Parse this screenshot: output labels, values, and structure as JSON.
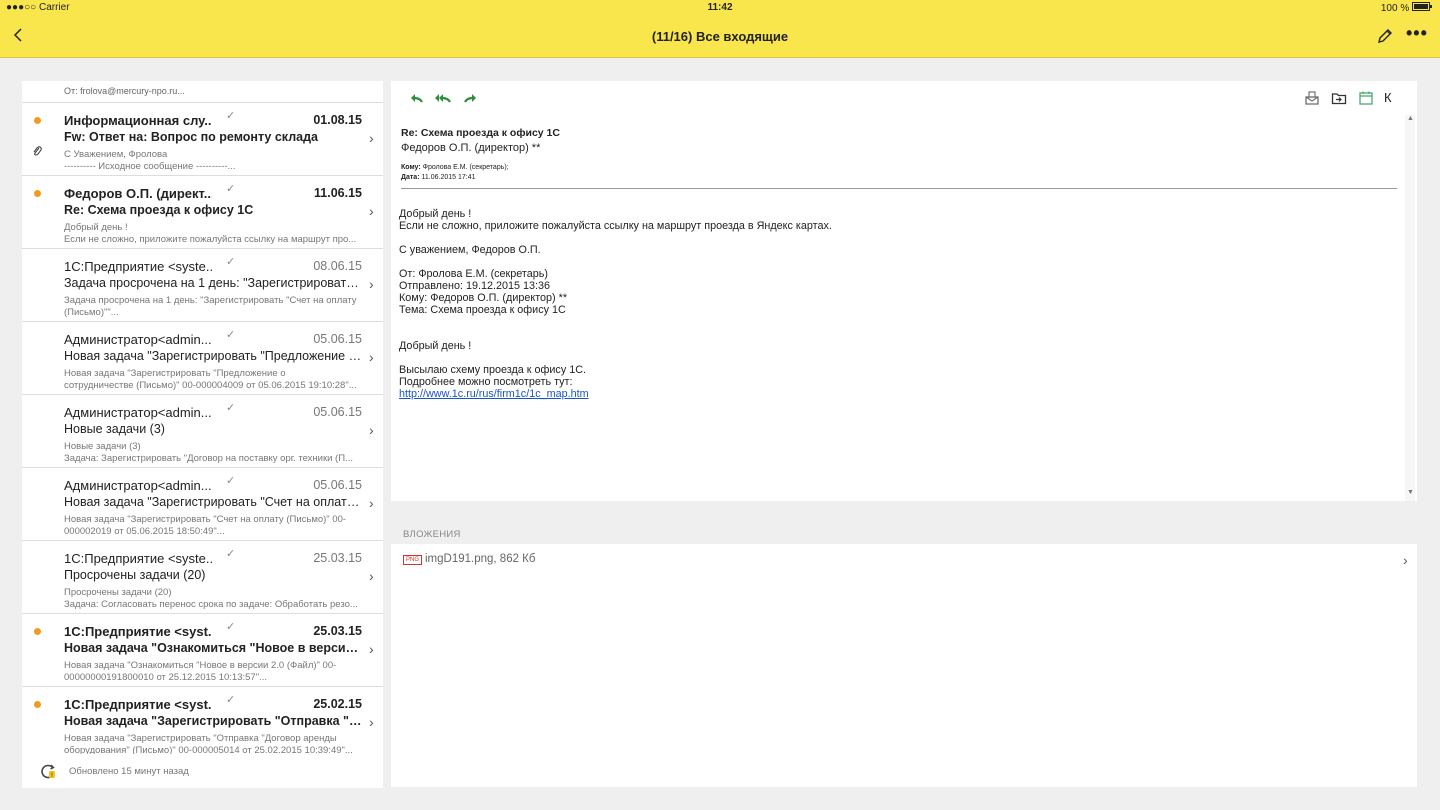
{
  "status": {
    "carrier": "●●●○○ Carrier",
    "time": "11:42",
    "battery": "100 %"
  },
  "header": {
    "title": "(11/16) Все входящие",
    "back_icon": "chevron-left-icon",
    "edit_icon": "pencil-icon",
    "more": "•••"
  },
  "list": {
    "top_from": "От: frolova@mercury-npo.ru...",
    "items": [
      {
        "unread": true,
        "attachment": true,
        "sender": "Информационная слу...",
        "date": "01.08.15",
        "subject": "Fw: Ответ на: Вопрос по ремонту склада",
        "preview": "С Уважением, Фролова\n---------- Исходное сообщение ----------..."
      },
      {
        "unread": true,
        "attachment": false,
        "sender": "Федоров О.П. (директ...",
        "date": "11.06.15",
        "subject": "Re: Схема проезда к офису 1С",
        "preview": "Добрый день !\nЕсли не сложно, приложите пожалуйста ссылку на маршрут про..."
      },
      {
        "unread": false,
        "attachment": false,
        "sender": "1С:Предприятие <syste...",
        "date": "08.06.15",
        "subject": "Задача просрочена на 1 день: \"Зарегистрировать \"С...",
        "preview": "Задача просрочена на 1 день: \"Зарегистрировать \"Счет на оплату\n(Письмо)\"\"..."
      },
      {
        "unread": false,
        "attachment": false,
        "sender": "Администратор<admin...",
        "date": "05.06.15",
        "subject": "Новая задача \"Зарегистрировать \"Предложение о с...",
        "preview": "Новая задача \"Зарегистрировать \"Предложение о\nсотрудничестве (Письмо)\" 00-000004009 от 05.06.2015 19:10:28\"..."
      },
      {
        "unread": false,
        "attachment": false,
        "sender": "Администратор<admin...",
        "date": "05.06.15",
        "subject": "Новые задачи (3)",
        "preview": "Новые задачи (3)\nЗадача: Зарегистрировать \"Договор на поставку орг. техники (П..."
      },
      {
        "unread": false,
        "attachment": false,
        "sender": "Администратор<admin...",
        "date": "05.06.15",
        "subject": "Новая задача \"Зарегистрировать \"Счет на оплату (П...",
        "preview": "Новая задача \"Зарегистрировать \"Счет на оплату (Письмо)\" 00-\n000002019 от 05.06.2015 18:50:49\"..."
      },
      {
        "unread": false,
        "attachment": false,
        "sender": "1С:Предприятие <syste...",
        "date": "25.03.15",
        "subject": "Просрочены задачи (20)",
        "preview": "Просрочены задачи (20)\nЗадача: Согласовать перенос срока по задаче: Обработать резо..."
      },
      {
        "unread": true,
        "attachment": false,
        "sender": "1С:Предприятие <syst...",
        "date": "25.03.15",
        "subject": "Новая задача \"Ознакомиться \"Новое в версии 2...",
        "preview": "Новая задача \"Ознакомиться \"Новое в версии 2.0 (Файл)\" 00-\n00000000191800010 от 25.12.2015 10:13:57\"..."
      },
      {
        "unread": true,
        "attachment": false,
        "sender": "1С:Предприятие <syst...",
        "date": "25.02.15",
        "subject": "Новая задача \"Зарегистрировать \"Отправка \"До...",
        "preview": "Новая задача \"Зарегистрировать \"Отправка \"Договор аренды\nоборудования\" (Письмо)\" 00-000005014 от 25.02.2015 10:39:49\"..."
      }
    ],
    "footer": "Обновлено 15 минут назад"
  },
  "email": {
    "toolbar": {
      "reply": "reply-icon",
      "reply_all": "reply-all-icon",
      "forward": "forward-icon",
      "k": "К"
    },
    "subject": "Re: Схема проезда к офису 1С",
    "from": "Федоров О.П. (директор) **",
    "to_label": "Кому:",
    "to": "Фролова Е.М. (секретарь);",
    "date_label": "Дата:",
    "date": "11.06.2015 17:41",
    "body": {
      "l1": "Добрый день !",
      "l2": "Если не сложно, приложите пожалуйста ссылку на маршрут проезда в Яндекс картах.",
      "l3": "С уважением, Федоров О.П.",
      "l4": "От: Фролова Е.М. (секретарь)",
      "l5": "Отправлено: 19.12.2015 13:36",
      "l6": "Кому: Федоров О.П. (директор) **",
      "l7": "Тема: Схема проезда к офису 1С",
      "l8": "Добрый день !",
      "l9": "Высылаю схему проезда к офису 1С.",
      "l10": "Подробнее можно посмотреть тут:",
      "link": "http://www.1c.ru/rus/firm1c/1c_map.htm"
    }
  },
  "attachments": {
    "label": "ВЛОЖЕНИЯ",
    "items": [
      {
        "badge": "PNG",
        "name": "imgD191.png, 862 Кб"
      }
    ]
  },
  "colors": {
    "header_bg": "#f9e54c",
    "unread_dot": "#f29b1e",
    "action_green": "#2d8f3d",
    "link": "#1a55c5"
  }
}
